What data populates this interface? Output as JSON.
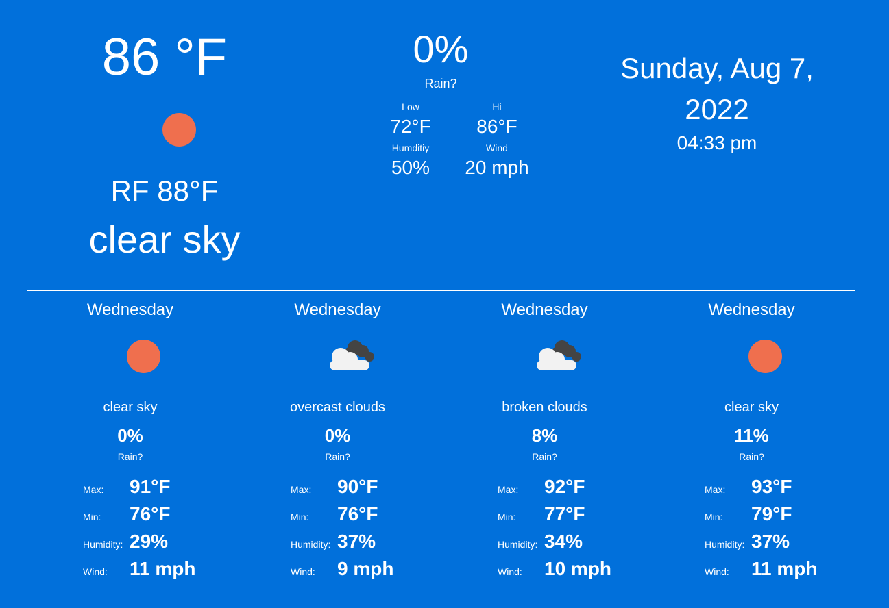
{
  "current": {
    "temperature": "86 °F",
    "real_feel": "RF 88°F",
    "description": "clear sky",
    "icon": "sun-icon",
    "rain_chance": "0%",
    "rain_label": "Rain?",
    "low_label": "Low",
    "low": "72°F",
    "hi_label": "Hi",
    "hi": "86°F",
    "humidity_label": "Humditiy",
    "humidity": "50%",
    "wind_label": "Wind",
    "wind": "20 mph"
  },
  "datetime": {
    "date": "Sunday, Aug 7, 2022",
    "time": "04:33 pm"
  },
  "forecast": [
    {
      "day": "Wednesday",
      "icon": "sun-icon",
      "description": "clear sky",
      "rain_chance": "0%",
      "rain_label": "Rain?",
      "max_label": "Max:",
      "max": "91°F",
      "min_label": "Min:",
      "min": "76°F",
      "humidity_label": "Humidity:",
      "humidity": "29%",
      "wind_label": "Wind:",
      "wind": "11 mph"
    },
    {
      "day": "Wednesday",
      "icon": "cloud-icon",
      "description": "overcast clouds",
      "rain_chance": "0%",
      "rain_label": "Rain?",
      "max_label": "Max:",
      "max": "90°F",
      "min_label": "Min:",
      "min": "76°F",
      "humidity_label": "Humidity:",
      "humidity": "37%",
      "wind_label": "Wind:",
      "wind": "9 mph"
    },
    {
      "day": "Wednesday",
      "icon": "cloud-icon",
      "description": "broken clouds",
      "rain_chance": "8%",
      "rain_label": "Rain?",
      "max_label": "Max:",
      "max": "92°F",
      "min_label": "Min:",
      "min": "77°F",
      "humidity_label": "Humidity:",
      "humidity": "34%",
      "wind_label": "Wind:",
      "wind": "10 mph"
    },
    {
      "day": "Wednesday",
      "icon": "sun-icon",
      "description": "clear sky",
      "rain_chance": "11%",
      "rain_label": "Rain?",
      "max_label": "Max:",
      "max": "93°F",
      "min_label": "Min:",
      "min": "79°F",
      "humidity_label": "Humidity:",
      "humidity": "37%",
      "wind_label": "Wind:",
      "wind": "11 mph"
    }
  ],
  "colors": {
    "background": "#0170db",
    "sun": "#ef6f4e",
    "cloud_front": "#f2f2f2",
    "cloud_back": "#444444"
  }
}
